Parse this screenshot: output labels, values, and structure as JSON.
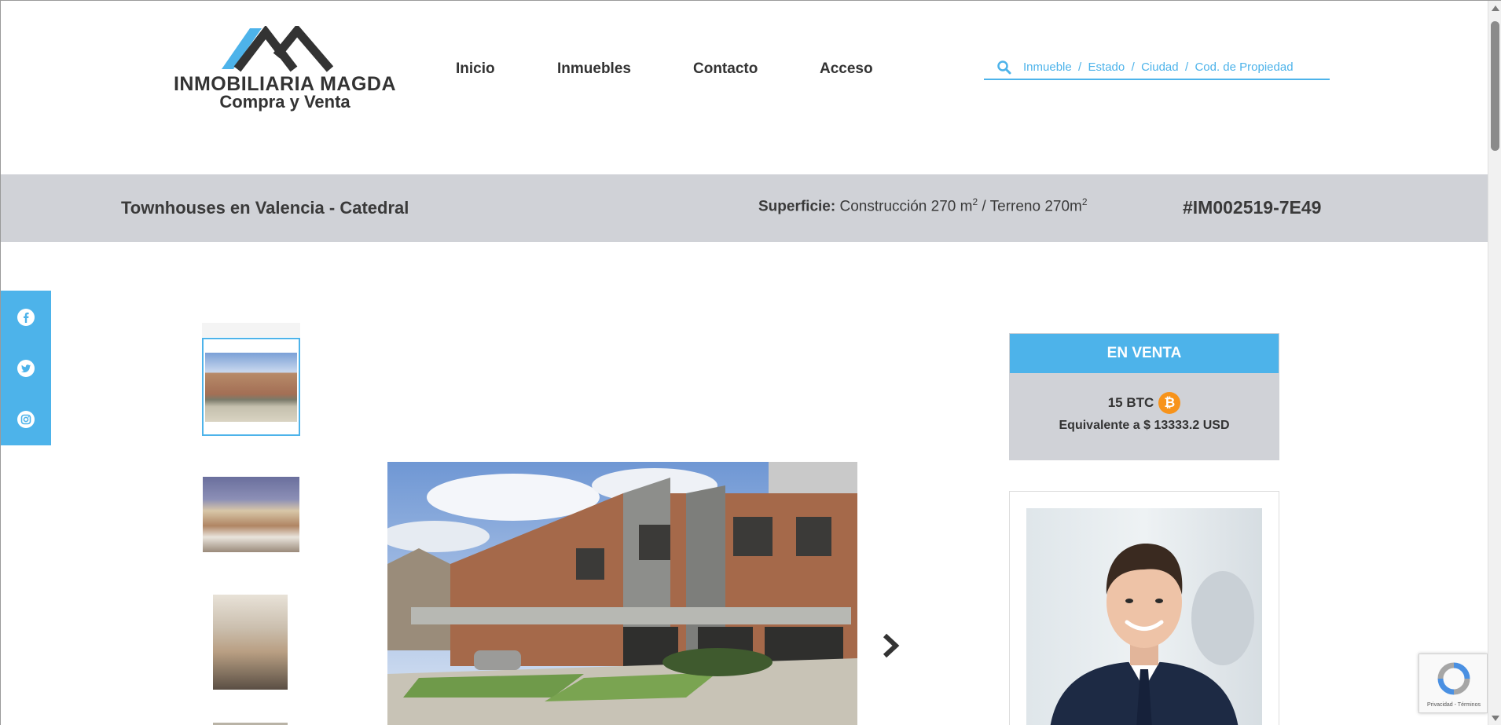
{
  "logo": {
    "line1": "INMOBILIARIA MAGDA",
    "line2": "Compra y Venta"
  },
  "nav": {
    "items": [
      "Inicio",
      "Inmuebles",
      "Contacto",
      "Acceso"
    ]
  },
  "search": {
    "placeholder": "Inmueble  /  Estado  /  Ciudad  /  Cod. de Propiedad",
    "icon": "search-icon"
  },
  "property": {
    "title": "Townhouses en Valencia - Catedral",
    "surface_label": "Superficie:",
    "surface_construction": "Construcción 270 m",
    "surface_sep": "/ Terreno 270m",
    "superscript": "2",
    "code": "#IM002519-7E49"
  },
  "social": {
    "icons": [
      "facebook-icon",
      "twitter-icon",
      "instagram-icon"
    ]
  },
  "price": {
    "status": "EN VENTA",
    "btc": "15 BTC",
    "btc_symbol": "₿",
    "usd": "Equivalente a $ 13333.2 USD"
  },
  "recaptcha": {
    "label": "Privacidad - Términos"
  },
  "colors": {
    "accent": "#4db3ea",
    "band": "#d0d2d7",
    "bitcoin": "#f7931a",
    "text": "#333333"
  }
}
